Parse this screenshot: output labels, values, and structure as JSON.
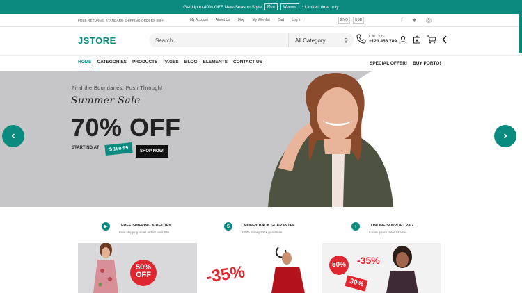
{
  "promo": {
    "text": "Get Up to 40% OFF New-Season Style",
    "men": "Men",
    "women": "Women",
    "suffix": "* Limited time only"
  },
  "topbar": {
    "shipping": "FREE RETURNS. STANDARD SHIPPING ORDERS $99+",
    "links": [
      "My Account",
      "About Us",
      "Blog",
      "My Wishlist",
      "Cart",
      "Log In"
    ],
    "language": "ENG",
    "currency": "USD",
    "social": [
      "facebook-icon",
      "twitter-icon",
      "instagram-icon"
    ]
  },
  "header": {
    "logo": "JSTORE",
    "search_placeholder": "Search...",
    "category": "All Category",
    "call_label": "CALL US",
    "phone": "+123 456 789"
  },
  "nav": {
    "items": [
      "HOME",
      "CATEGORIES",
      "PRODUCTS",
      "PAGES",
      "BLOG",
      "ELEMENTS",
      "CONTACT US"
    ],
    "right": [
      "SPECIAL OFFER!",
      "BUY PORTO!"
    ]
  },
  "hero": {
    "tagline": "Find the Boundaries. Push Through!",
    "title": "Summer Sale",
    "headline": "70% OFF",
    "starting": "STARTING AT",
    "price": "$ 199.99",
    "cta": "SHOP NOW!"
  },
  "features": [
    {
      "icon": "truck-icon",
      "title": "FREE SHIPPING & RETURN",
      "subtitle": "Free shipping on all orders over $99"
    },
    {
      "icon": "money-bag-icon",
      "title": "MONEY BACK GUARANTEE",
      "subtitle": "100% money back guarantee"
    },
    {
      "icon": "info-icon",
      "title": "ONLINE SUPPORT 24/7",
      "subtitle": "Lorem ipsum dolor sit amet."
    }
  ],
  "promos": {
    "card1": "50% OFF",
    "card2": "-35%",
    "card3a": "50%",
    "card3b": "-35%",
    "card3c": "30%"
  },
  "colors": {
    "brand": "#0b8a7f",
    "hero_bg": "#c6c6c8"
  }
}
